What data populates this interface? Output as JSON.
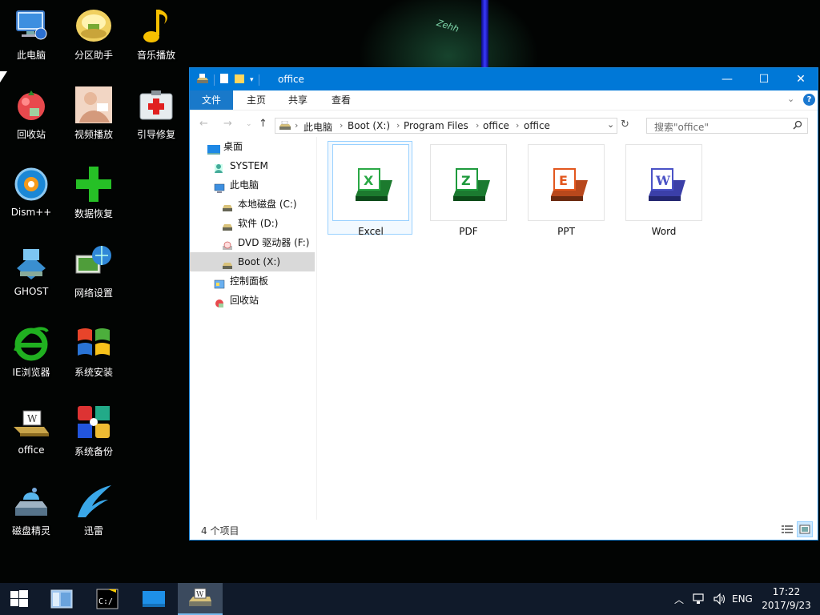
{
  "desktop": {
    "icons": [
      {
        "label": "此电脑",
        "icon": "computer-icon"
      },
      {
        "label": "分区助手",
        "icon": "partition-assistant-icon"
      },
      {
        "label": "音乐播放",
        "icon": "music-note-icon"
      },
      {
        "label": "回收站",
        "icon": "recycle-bin-icon"
      },
      {
        "label": "视频播放",
        "icon": "video-player-icon"
      },
      {
        "label": "引导修复",
        "icon": "first-aid-kit-icon"
      },
      {
        "label": "Dism++",
        "icon": "dism-icon"
      },
      {
        "label": "数据恢复",
        "icon": "green-plus-icon"
      },
      {
        "label": "GHOST",
        "icon": "ghost-icon"
      },
      {
        "label": "网络设置",
        "icon": "network-globe-icon"
      },
      {
        "label": "IE浏览器",
        "icon": "ie-browser-icon"
      },
      {
        "label": "系统安装",
        "icon": "windows-flag-icon"
      },
      {
        "label": "office",
        "icon": "office-drive-icon"
      },
      {
        "label": "系统备份",
        "icon": "backup-tiles-icon"
      },
      {
        "label": "磁盘精灵",
        "icon": "disk-genius-icon"
      },
      {
        "label": "迅雷",
        "icon": "thunder-bird-icon"
      }
    ],
    "wallpaper_text": "Zehh"
  },
  "window": {
    "title": "office",
    "ribbon_tabs": [
      "文件",
      "主页",
      "共享",
      "查看"
    ],
    "address": {
      "breadcrumbs": [
        "此电脑",
        "Boot (X:)",
        "Program Files",
        "office",
        "office"
      ]
    },
    "search": {
      "placeholder": "搜索\"office\""
    },
    "nav": [
      {
        "label": "桌面",
        "icon": "desktop-icon"
      },
      {
        "label": "SYSTEM",
        "icon": "user-folder-icon"
      },
      {
        "label": "此电脑",
        "icon": "computer-icon"
      },
      {
        "label": "本地磁盘 (C:)",
        "icon": "drive-icon"
      },
      {
        "label": "软件 (D:)",
        "icon": "drive-icon"
      },
      {
        "label": "DVD 驱动器 (F:)",
        "icon": "dvd-icon"
      },
      {
        "label": "Boot (X:)",
        "icon": "drive-icon",
        "selected": true
      },
      {
        "label": "控制面板",
        "icon": "control-panel-icon"
      },
      {
        "label": "回收站",
        "icon": "recycle-bin-icon"
      }
    ],
    "files": [
      {
        "name": "Excel",
        "icon": "excel-icon",
        "letter": "X",
        "color": "#2aa845",
        "selected": true
      },
      {
        "name": "PDF",
        "icon": "pdf-icon",
        "letter": "Z",
        "color": "#1e9a3c"
      },
      {
        "name": "PPT",
        "icon": "ppt-icon",
        "letter": "E",
        "color": "#e2571e"
      },
      {
        "name": "Word",
        "icon": "word-icon",
        "letter": "W",
        "color": "#4a52c6"
      }
    ],
    "status": {
      "item_count": "4 个项目"
    }
  },
  "taskbar": {
    "tray_language": "ENG",
    "clock_time": "17:22",
    "clock_date": "2017/9/23"
  },
  "colors": {
    "accent": "#0078d7",
    "file_tab": "#1979ca",
    "taskbar": "#101a2a",
    "selection": "#99d1ff"
  }
}
